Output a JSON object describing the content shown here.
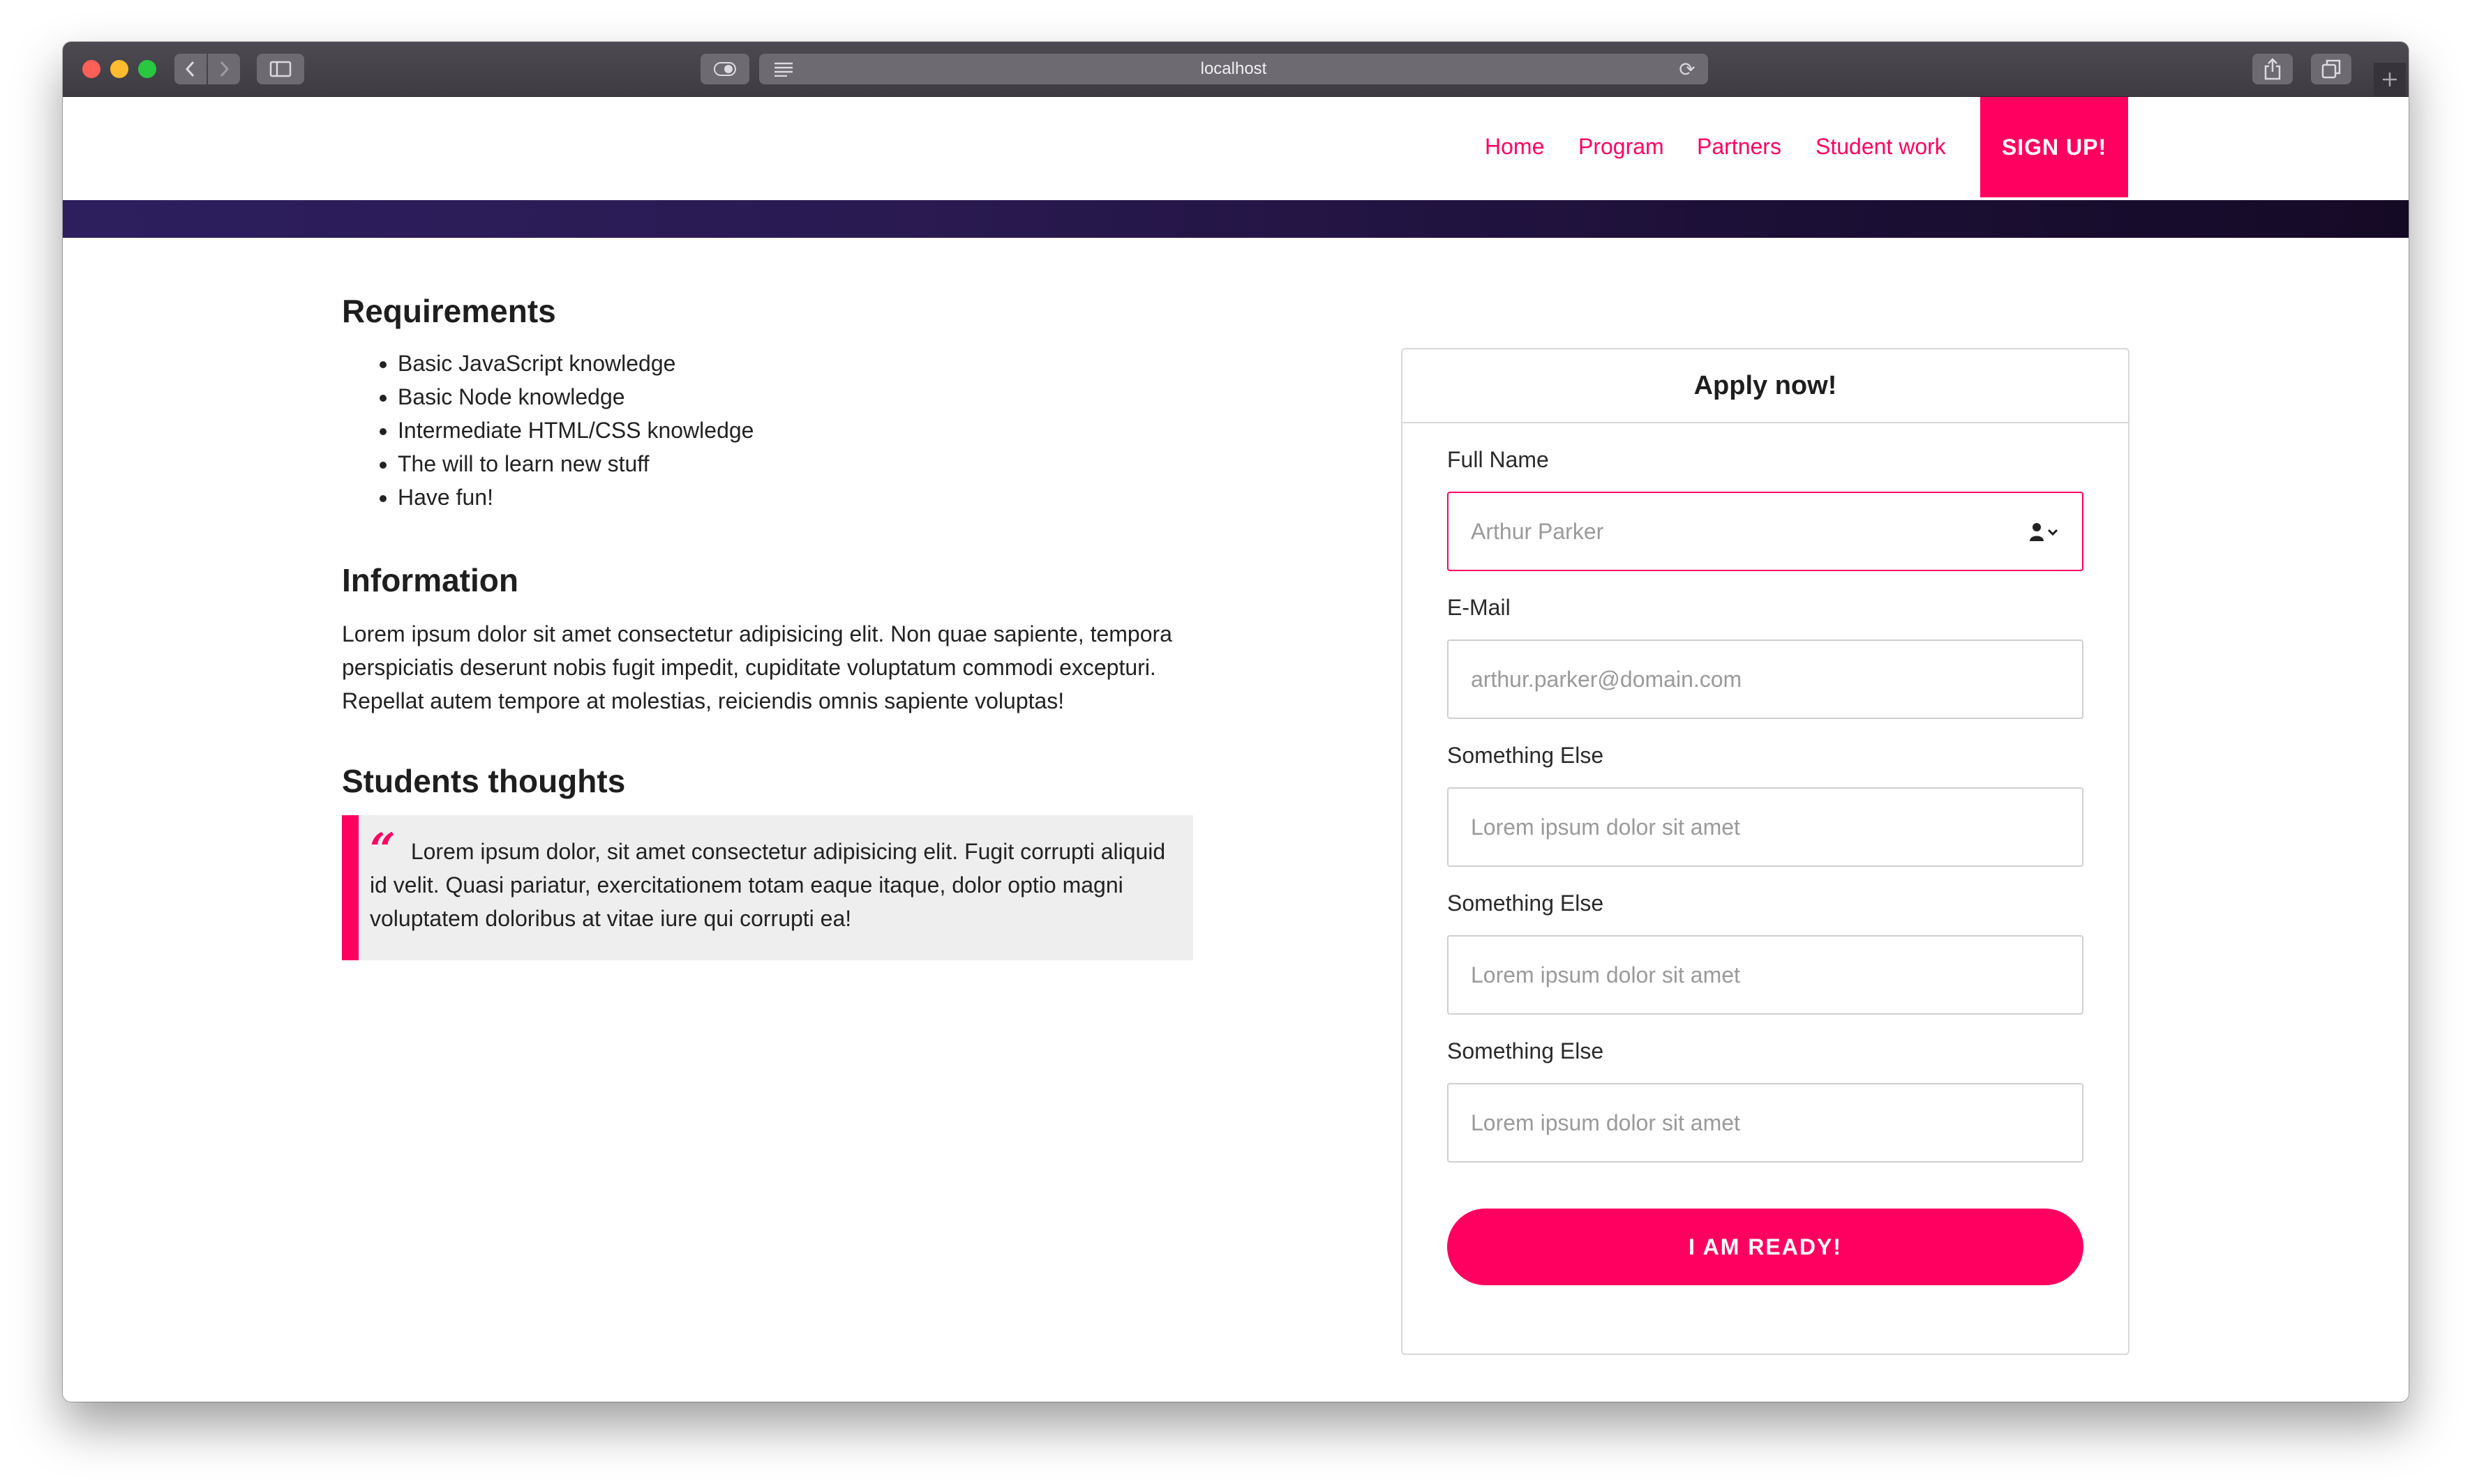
{
  "browser": {
    "url": "localhost",
    "icons": {
      "back": "chevron-left-icon",
      "forward": "chevron-right-icon",
      "sidebar": "sidebar-icon",
      "privacy": "toggle-icon",
      "reader": "reader-icon",
      "reload": "reload-icon",
      "share": "share-icon",
      "tabs": "tabs-icon",
      "new_tab": "plus-icon"
    }
  },
  "colors": {
    "accent": "#ff0061",
    "hero_strip": "#2d1e5e",
    "quote_bg": "#eeeeee"
  },
  "nav": {
    "links": [
      "Home",
      "Program",
      "Partners",
      "Student work"
    ],
    "signup": "SIGN UP!"
  },
  "requirements": {
    "title": "Requirements",
    "items": [
      "Basic JavaScript knowledge",
      "Basic Node knowledge",
      "Intermediate HTML/CSS knowledge",
      "The will to learn new stuff",
      "Have fun!"
    ]
  },
  "information": {
    "title": "Information",
    "text": "Lorem ipsum dolor sit amet consectetur adipisicing elit. Non quae sapiente, tempora perspiciatis deserunt nobis fugit impedit, cupiditate voluptatum commodi excepturi. Repellat autem tempore at molestias, reiciendis omnis sapiente voluptas!"
  },
  "students": {
    "title": "Students thoughts",
    "quote_mark": "“",
    "quote": "Lorem ipsum dolor, sit amet consectetur adipisicing elit. Fugit corrupti aliquid id velit. Quasi pariatur, exercitationem totam eaque itaque, dolor optio magni voluptatem doloribus at vitae iure qui corrupti ea!"
  },
  "form": {
    "title": "Apply now!",
    "fields": [
      {
        "label": "Full Name",
        "placeholder": "Arthur Parker",
        "value": ""
      },
      {
        "label": "E-Mail",
        "placeholder": "arthur.parker@domain.com",
        "value": ""
      },
      {
        "label": "Something Else",
        "placeholder": "Lorem ipsum dolor sit amet",
        "value": ""
      },
      {
        "label": "Something Else",
        "placeholder": "Lorem ipsum dolor sit amet",
        "value": ""
      },
      {
        "label": "Something Else",
        "placeholder": "Lorem ipsum dolor sit amet",
        "value": ""
      }
    ],
    "autofill_icon": "contact-autofill-icon",
    "submit": "I AM READY!"
  }
}
